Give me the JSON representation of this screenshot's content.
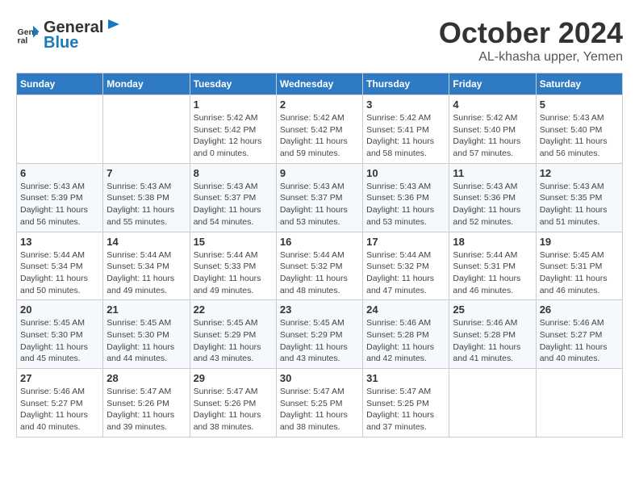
{
  "header": {
    "logo_line1": "General",
    "logo_line2": "Blue",
    "month": "October 2024",
    "location": "AL-khasha upper, Yemen"
  },
  "columns": [
    "Sunday",
    "Monday",
    "Tuesday",
    "Wednesday",
    "Thursday",
    "Friday",
    "Saturday"
  ],
  "weeks": [
    [
      {
        "day": "",
        "detail": ""
      },
      {
        "day": "",
        "detail": ""
      },
      {
        "day": "1",
        "detail": "Sunrise: 5:42 AM\nSunset: 5:42 PM\nDaylight: 12 hours\nand 0 minutes."
      },
      {
        "day": "2",
        "detail": "Sunrise: 5:42 AM\nSunset: 5:42 PM\nDaylight: 11 hours\nand 59 minutes."
      },
      {
        "day": "3",
        "detail": "Sunrise: 5:42 AM\nSunset: 5:41 PM\nDaylight: 11 hours\nand 58 minutes."
      },
      {
        "day": "4",
        "detail": "Sunrise: 5:42 AM\nSunset: 5:40 PM\nDaylight: 11 hours\nand 57 minutes."
      },
      {
        "day": "5",
        "detail": "Sunrise: 5:43 AM\nSunset: 5:40 PM\nDaylight: 11 hours\nand 56 minutes."
      }
    ],
    [
      {
        "day": "6",
        "detail": "Sunrise: 5:43 AM\nSunset: 5:39 PM\nDaylight: 11 hours\nand 56 minutes."
      },
      {
        "day": "7",
        "detail": "Sunrise: 5:43 AM\nSunset: 5:38 PM\nDaylight: 11 hours\nand 55 minutes."
      },
      {
        "day": "8",
        "detail": "Sunrise: 5:43 AM\nSunset: 5:37 PM\nDaylight: 11 hours\nand 54 minutes."
      },
      {
        "day": "9",
        "detail": "Sunrise: 5:43 AM\nSunset: 5:37 PM\nDaylight: 11 hours\nand 53 minutes."
      },
      {
        "day": "10",
        "detail": "Sunrise: 5:43 AM\nSunset: 5:36 PM\nDaylight: 11 hours\nand 53 minutes."
      },
      {
        "day": "11",
        "detail": "Sunrise: 5:43 AM\nSunset: 5:36 PM\nDaylight: 11 hours\nand 52 minutes."
      },
      {
        "day": "12",
        "detail": "Sunrise: 5:43 AM\nSunset: 5:35 PM\nDaylight: 11 hours\nand 51 minutes."
      }
    ],
    [
      {
        "day": "13",
        "detail": "Sunrise: 5:44 AM\nSunset: 5:34 PM\nDaylight: 11 hours\nand 50 minutes."
      },
      {
        "day": "14",
        "detail": "Sunrise: 5:44 AM\nSunset: 5:34 PM\nDaylight: 11 hours\nand 49 minutes."
      },
      {
        "day": "15",
        "detail": "Sunrise: 5:44 AM\nSunset: 5:33 PM\nDaylight: 11 hours\nand 49 minutes."
      },
      {
        "day": "16",
        "detail": "Sunrise: 5:44 AM\nSunset: 5:32 PM\nDaylight: 11 hours\nand 48 minutes."
      },
      {
        "day": "17",
        "detail": "Sunrise: 5:44 AM\nSunset: 5:32 PM\nDaylight: 11 hours\nand 47 minutes."
      },
      {
        "day": "18",
        "detail": "Sunrise: 5:44 AM\nSunset: 5:31 PM\nDaylight: 11 hours\nand 46 minutes."
      },
      {
        "day": "19",
        "detail": "Sunrise: 5:45 AM\nSunset: 5:31 PM\nDaylight: 11 hours\nand 46 minutes."
      }
    ],
    [
      {
        "day": "20",
        "detail": "Sunrise: 5:45 AM\nSunset: 5:30 PM\nDaylight: 11 hours\nand 45 minutes."
      },
      {
        "day": "21",
        "detail": "Sunrise: 5:45 AM\nSunset: 5:30 PM\nDaylight: 11 hours\nand 44 minutes."
      },
      {
        "day": "22",
        "detail": "Sunrise: 5:45 AM\nSunset: 5:29 PM\nDaylight: 11 hours\nand 43 minutes."
      },
      {
        "day": "23",
        "detail": "Sunrise: 5:45 AM\nSunset: 5:29 PM\nDaylight: 11 hours\nand 43 minutes."
      },
      {
        "day": "24",
        "detail": "Sunrise: 5:46 AM\nSunset: 5:28 PM\nDaylight: 11 hours\nand 42 minutes."
      },
      {
        "day": "25",
        "detail": "Sunrise: 5:46 AM\nSunset: 5:28 PM\nDaylight: 11 hours\nand 41 minutes."
      },
      {
        "day": "26",
        "detail": "Sunrise: 5:46 AM\nSunset: 5:27 PM\nDaylight: 11 hours\nand 40 minutes."
      }
    ],
    [
      {
        "day": "27",
        "detail": "Sunrise: 5:46 AM\nSunset: 5:27 PM\nDaylight: 11 hours\nand 40 minutes."
      },
      {
        "day": "28",
        "detail": "Sunrise: 5:47 AM\nSunset: 5:26 PM\nDaylight: 11 hours\nand 39 minutes."
      },
      {
        "day": "29",
        "detail": "Sunrise: 5:47 AM\nSunset: 5:26 PM\nDaylight: 11 hours\nand 38 minutes."
      },
      {
        "day": "30",
        "detail": "Sunrise: 5:47 AM\nSunset: 5:25 PM\nDaylight: 11 hours\nand 38 minutes."
      },
      {
        "day": "31",
        "detail": "Sunrise: 5:47 AM\nSunset: 5:25 PM\nDaylight: 11 hours\nand 37 minutes."
      },
      {
        "day": "",
        "detail": ""
      },
      {
        "day": "",
        "detail": ""
      }
    ]
  ]
}
